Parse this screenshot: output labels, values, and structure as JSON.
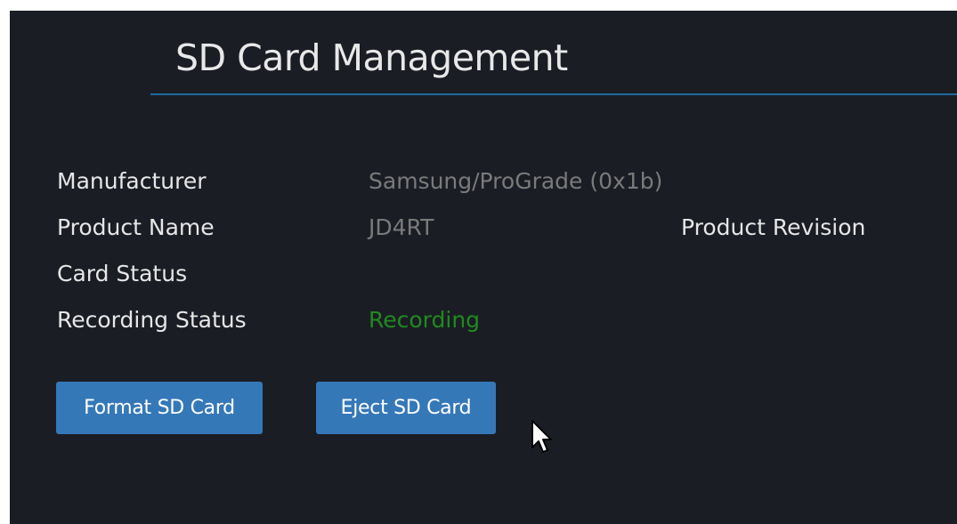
{
  "page": {
    "title": "SD Card Management"
  },
  "details": {
    "manufacturer_label": "Manufacturer",
    "manufacturer_value": "Samsung/ProGrade (0x1b)",
    "product_name_label": "Product Name",
    "product_name_value": "JD4RT",
    "product_revision_label": "Product Revision",
    "card_status_label": "Card Status",
    "card_status_value": "",
    "recording_status_label": "Recording Status",
    "recording_status_value": "Recording"
  },
  "actions": {
    "format_label": "Format SD Card",
    "eject_label": "Eject SD Card"
  },
  "colors": {
    "background": "#1b1d24",
    "accent_rule": "#1f6a9e",
    "button": "#3578b8",
    "recording_green": "#1f8a1f"
  },
  "icons": {
    "cursor": "mouse-pointer-icon"
  }
}
